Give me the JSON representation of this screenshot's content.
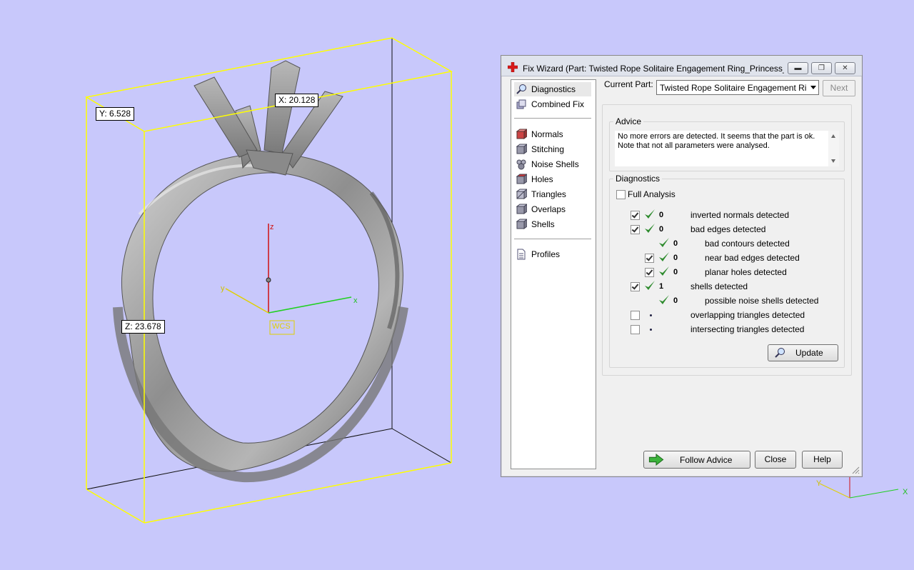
{
  "viewport": {
    "dimensions": {
      "x": "X: 20.128",
      "y": "Y: 6.528",
      "z": "Z: 23.678"
    },
    "axes": {
      "x": "x",
      "y": "y",
      "z": "z",
      "wcs": "WCS"
    },
    "corner_axes": {
      "x": "X",
      "y": "Y"
    }
  },
  "dialog": {
    "title": "Fix Wizard (Part: Twisted Rope Solitaire Engagement Ring_Princess_...",
    "nav": {
      "items": [
        "Diagnostics",
        "Combined Fix",
        "Normals",
        "Stitching",
        "Noise Shells",
        "Holes",
        "Triangles",
        "Overlaps",
        "Shells",
        "Profiles"
      ],
      "selected": "Diagnostics"
    },
    "current_part_label": "Current Part:",
    "current_part_value": "Twisted Rope Solitaire Engagement Ring_Princess",
    "next_label": "Next",
    "advice": {
      "title": "Advice",
      "text": "No more errors are detected. It seems that the part is ok. Note that not all parameters were analysed."
    },
    "diagnostics": {
      "title": "Diagnostics",
      "full_analysis_label": "Full Analysis",
      "rows": [
        {
          "count": "0",
          "text": "inverted normals detected"
        },
        {
          "count": "0",
          "text": "bad edges detected"
        },
        {
          "count": "0",
          "text": "bad contours detected"
        },
        {
          "count": "0",
          "text": "near bad edges detected"
        },
        {
          "count": "0",
          "text": "planar holes detected"
        },
        {
          "count": "1",
          "text": "shells detected"
        },
        {
          "count": "0",
          "text": "possible noise shells detected"
        },
        {
          "count": "",
          "text": "overlapping triangles detected"
        },
        {
          "count": "",
          "text": "intersecting triangles detected"
        }
      ],
      "update_label": "Update"
    },
    "buttons": {
      "follow_advice": "Follow Advice",
      "close": "Close",
      "help": "Help"
    },
    "colors": {
      "accent_check": "#2e8b2e",
      "title_icon": "#d91a1a",
      "bbox": "#ffff00"
    }
  }
}
